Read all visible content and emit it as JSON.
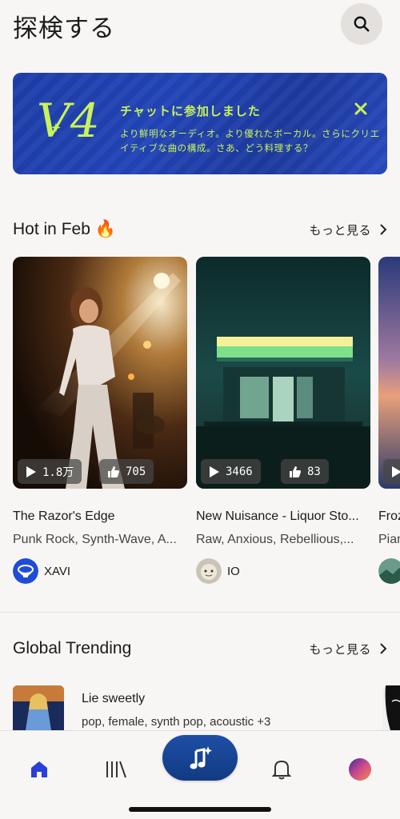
{
  "header": {
    "title": "探検する"
  },
  "banner": {
    "logo_text": "V4",
    "heading": "チャットに参加しました",
    "body": "より鮮明なオーディオ。より優れたボーカル。さらにクリエイティブな曲の構成。さあ、どう料理する？",
    "accent_color": "#c9f25a",
    "background_color": "#2244b8"
  },
  "hot": {
    "title": "Hot in Feb",
    "emoji": "🔥",
    "see_more": "もっと見る",
    "cards": [
      {
        "title": "The Razor's Edge",
        "tags": "Punk Rock, Synth-Wave, A...",
        "plays": "1.8万",
        "likes": "705",
        "user": "XAVI"
      },
      {
        "title": "New Nuisance - Liquor Sto...",
        "tags": "Raw, Anxious, Rebellious,...",
        "plays": "3466",
        "likes": "83",
        "user": "IO"
      },
      {
        "title": "Froz",
        "tags": "Pian",
        "plays": "",
        "likes": "",
        "user": ""
      }
    ]
  },
  "trending": {
    "title": "Global Trending",
    "see_more": "もっと見る",
    "items": [
      {
        "title": "Lie sweetly",
        "tags": "pop, female, synth pop, acoustic +3"
      }
    ]
  },
  "tabbar": {
    "items": [
      "home-icon",
      "library-icon",
      "create-icon",
      "bell-icon",
      "profile-avatar"
    ],
    "active_color": "#2a3fd6"
  }
}
